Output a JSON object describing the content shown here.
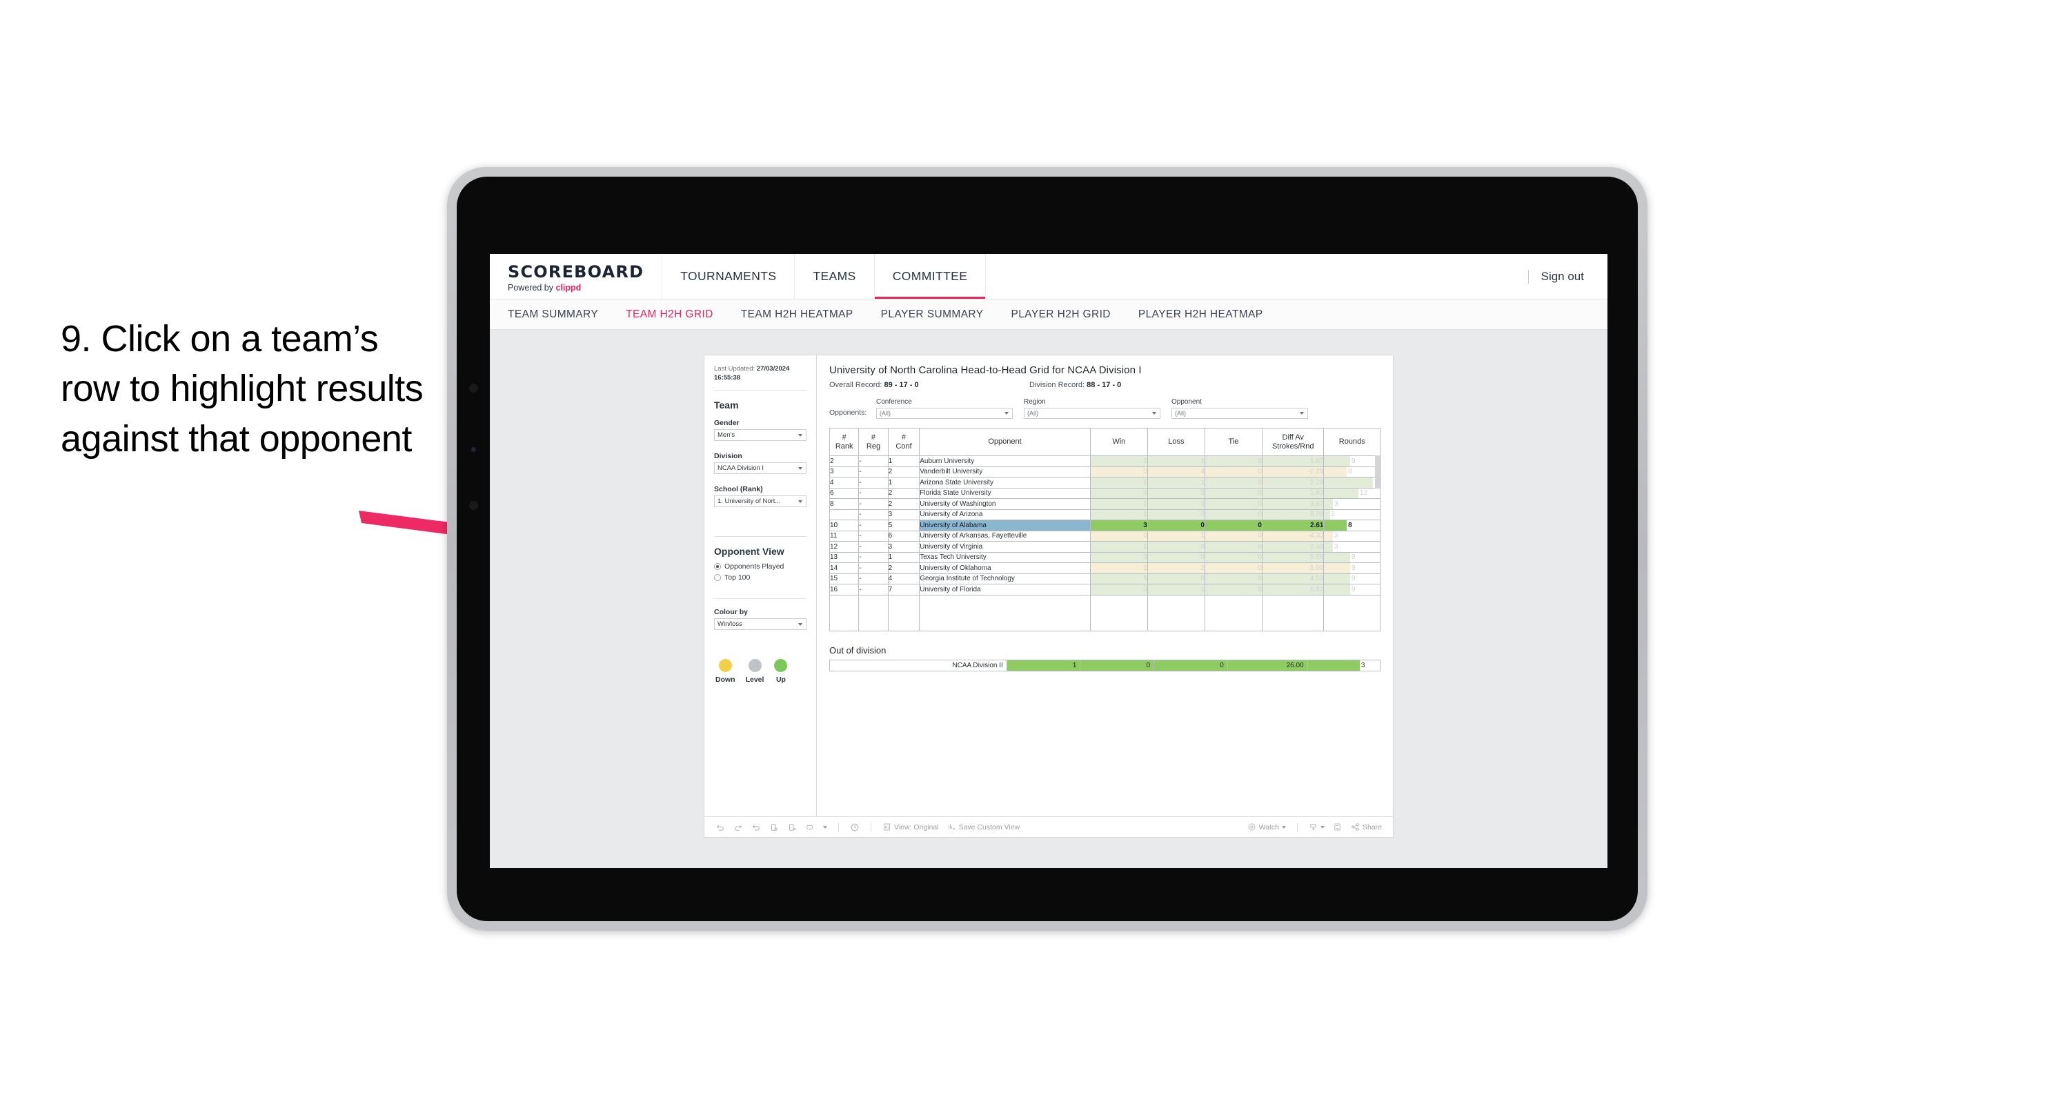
{
  "caption": "9. Click on a team’s row to highlight results against that opponent",
  "brand": {
    "title": "SCOREBOARD",
    "powered_prefix": "Powered by ",
    "powered_name": "clippd"
  },
  "topnav": {
    "tabs": [
      {
        "label": "TOURNAMENTS",
        "active": false
      },
      {
        "label": "TEAMS",
        "active": false
      },
      {
        "label": "COMMITTEE",
        "active": true
      }
    ],
    "sign_out": "Sign out"
  },
  "subnav": {
    "tabs": [
      {
        "label": "TEAM SUMMARY",
        "active": false
      },
      {
        "label": "TEAM H2H GRID",
        "active": true
      },
      {
        "label": "TEAM H2H HEATMAP",
        "active": false
      },
      {
        "label": "PLAYER SUMMARY",
        "active": false
      },
      {
        "label": "PLAYER H2H GRID",
        "active": false
      },
      {
        "label": "PLAYER H2H HEATMAP",
        "active": false
      }
    ]
  },
  "sidebar": {
    "last_updated_label": "Last Updated:",
    "last_updated_value": "27/03/2024 16:55:38",
    "team_heading": "Team",
    "gender": {
      "label": "Gender",
      "value": "Men’s"
    },
    "division": {
      "label": "Division",
      "value": "NCAA Division I"
    },
    "school": {
      "label": "School (Rank)",
      "value": "1. University of Nort..."
    },
    "opponent_view": {
      "heading": "Opponent View",
      "options": [
        {
          "label": "Opponents Played",
          "selected": true
        },
        {
          "label": "Top 100",
          "selected": false
        }
      ]
    },
    "colour_by": {
      "label": "Colour by",
      "value": "Win/loss"
    },
    "legend": [
      {
        "label": "Down",
        "color": "#f2cf4b"
      },
      {
        "label": "Level",
        "color": "#bfc3c6"
      },
      {
        "label": "Up",
        "color": "#7dc75a"
      }
    ]
  },
  "viz": {
    "title": "University of North Carolina Head-to-Head Grid for NCAA Division I",
    "overall_record_label": "Overall Record:",
    "overall_record_value": "89 - 17 - 0",
    "division_record_label": "Division Record:",
    "division_record_value": "88 - 17 - 0",
    "filters_label": "Opponents:",
    "filters": [
      {
        "label": "Conference",
        "value": "(All)"
      },
      {
        "label": "Region",
        "value": "(All)"
      },
      {
        "label": "Opponent",
        "value": "(All)"
      }
    ],
    "columns": [
      "# Rank",
      "# Reg",
      "# Conf",
      "Opponent",
      "Win",
      "Loss",
      "Tie",
      "Diff Av Strokes/Rnd",
      "Rounds"
    ],
    "columns_split": [
      {
        "l1": "#",
        "l2": "Rank"
      },
      {
        "l1": "#",
        "l2": "Reg"
      },
      {
        "l1": "#",
        "l2": "Conf"
      },
      {
        "l1": "Opponent",
        "l2": ""
      },
      {
        "l1": "Win",
        "l2": ""
      },
      {
        "l1": "Loss",
        "l2": ""
      },
      {
        "l1": "Tie",
        "l2": ""
      },
      {
        "l1": "Diff Av",
        "l2": "Strokes/Rnd"
      },
      {
        "l1": "Rounds",
        "l2": ""
      }
    ],
    "rows": [
      {
        "rank": "2",
        "reg": "-",
        "conf": "1",
        "opponent": "Auburn University",
        "win": "2",
        "loss": "1",
        "tie": "0",
        "diff": "1.67",
        "rounds": "9",
        "color": "up",
        "selected": false
      },
      {
        "rank": "3",
        "reg": "-",
        "conf": "2",
        "opponent": "Vanderbilt University",
        "win": "0",
        "loss": "4",
        "tie": "0",
        "diff": "-2.29",
        "rounds": "8",
        "color": "down",
        "selected": false
      },
      {
        "rank": "4",
        "reg": "-",
        "conf": "1",
        "opponent": "Arizona State University",
        "win": "5",
        "loss": "1",
        "tie": "0",
        "diff": "2.28",
        "rounds": "17",
        "color": "up",
        "selected": false
      },
      {
        "rank": "6",
        "reg": "-",
        "conf": "2",
        "opponent": "Florida State University",
        "win": "4",
        "loss": "2",
        "tie": "0",
        "diff": "1.83",
        "rounds": "12",
        "color": "up",
        "selected": false
      },
      {
        "rank": "8",
        "reg": "-",
        "conf": "2",
        "opponent": "University of Washington",
        "win": "1",
        "loss": "0",
        "tie": "0",
        "diff": "3.67",
        "rounds": "3",
        "color": "up",
        "selected": false
      },
      {
        "rank": "",
        "reg": "-",
        "conf": "3",
        "opponent": "University of Arizona",
        "win": "1",
        "loss": "0",
        "tie": "0",
        "diff": "9.00",
        "rounds": "2",
        "color": "up",
        "selected": false
      },
      {
        "rank": "10",
        "reg": "-",
        "conf": "5",
        "opponent": "University of Alabama",
        "win": "3",
        "loss": "0",
        "tie": "0",
        "diff": "2.61",
        "rounds": "8",
        "color": "up",
        "selected": true
      },
      {
        "rank": "11",
        "reg": "-",
        "conf": "6",
        "opponent": "University of Arkansas, Fayetteville",
        "win": "0",
        "loss": "1",
        "tie": "0",
        "diff": "-4.33",
        "rounds": "3",
        "color": "down",
        "selected": false
      },
      {
        "rank": "12",
        "reg": "-",
        "conf": "3",
        "opponent": "University of Virginia",
        "win": "1",
        "loss": "0",
        "tie": "0",
        "diff": "2.33",
        "rounds": "3",
        "color": "up",
        "selected": false
      },
      {
        "rank": "13",
        "reg": "-",
        "conf": "1",
        "opponent": "Texas Tech University",
        "win": "3",
        "loss": "0",
        "tie": "0",
        "diff": "5.56",
        "rounds": "9",
        "color": "up",
        "selected": false
      },
      {
        "rank": "14",
        "reg": "-",
        "conf": "2",
        "opponent": "University of Oklahoma",
        "win": "1",
        "loss": "2",
        "tie": "0",
        "diff": "-1.00",
        "rounds": "9",
        "color": "down",
        "selected": false
      },
      {
        "rank": "15",
        "reg": "-",
        "conf": "4",
        "opponent": "Georgia Institute of Technology",
        "win": "5",
        "loss": "0",
        "tie": "0",
        "diff": "4.50",
        "rounds": "9",
        "color": "up",
        "selected": false
      },
      {
        "rank": "16",
        "reg": "-",
        "conf": "7",
        "opponent": "University of Florida",
        "win": "3",
        "loss": "1",
        "tie": "0",
        "diff": "6.62",
        "rounds": "9",
        "color": "up",
        "selected": false
      }
    ],
    "out_of_division": {
      "title": "Out of division",
      "row": {
        "label": "NCAA Division II",
        "win": "1",
        "loss": "0",
        "tie": "0",
        "diff": "26.00",
        "rounds": "3",
        "color": "up"
      }
    }
  },
  "toolbar": {
    "view_label": "View: Original",
    "save_label": "Save Custom View",
    "watch_label": "Watch",
    "share_label": "Share"
  },
  "chart_data": {
    "type": "table",
    "title": "University of North Carolina Head-to-Head Grid for NCAA Division I",
    "columns": [
      "# Rank",
      "# Reg",
      "# Conf",
      "Opponent",
      "Win",
      "Loss",
      "Tie",
      "Diff Av Strokes/Rnd",
      "Rounds"
    ],
    "rows": [
      [
        "2",
        "-",
        "1",
        "Auburn University",
        2,
        1,
        0,
        1.67,
        9
      ],
      [
        "3",
        "-",
        "2",
        "Vanderbilt University",
        0,
        4,
        0,
        -2.29,
        8
      ],
      [
        "4",
        "-",
        "1",
        "Arizona State University",
        5,
        1,
        0,
        2.28,
        17
      ],
      [
        "6",
        "-",
        "2",
        "Florida State University",
        4,
        2,
        0,
        1.83,
        12
      ],
      [
        "8",
        "-",
        "2",
        "University of Washington",
        1,
        0,
        0,
        3.67,
        3
      ],
      [
        "",
        "-",
        "3",
        "University of Arizona",
        1,
        0,
        0,
        9.0,
        2
      ],
      [
        "10",
        "-",
        "5",
        "University of Alabama",
        3,
        0,
        0,
        2.61,
        8
      ],
      [
        "11",
        "-",
        "6",
        "University of Arkansas, Fayetteville",
        0,
        1,
        0,
        -4.33,
        3
      ],
      [
        "12",
        "-",
        "3",
        "University of Virginia",
        1,
        0,
        0,
        2.33,
        3
      ],
      [
        "13",
        "-",
        "1",
        "Texas Tech University",
        3,
        0,
        0,
        5.56,
        9
      ],
      [
        "14",
        "-",
        "2",
        "University of Oklahoma",
        1,
        2,
        0,
        -1.0,
        9
      ],
      [
        "15",
        "-",
        "4",
        "Georgia Institute of Technology",
        5,
        0,
        0,
        4.5,
        9
      ],
      [
        "16",
        "-",
        "7",
        "University of Florida",
        3,
        1,
        0,
        6.62,
        9
      ]
    ],
    "out_of_division": [
      [
        "NCAA Division II",
        1,
        0,
        0,
        26.0,
        3
      ]
    ],
    "colour_by": "Win/loss",
    "legend": [
      "Down",
      "Level",
      "Up"
    ],
    "selected_row": "University of Alabama"
  }
}
